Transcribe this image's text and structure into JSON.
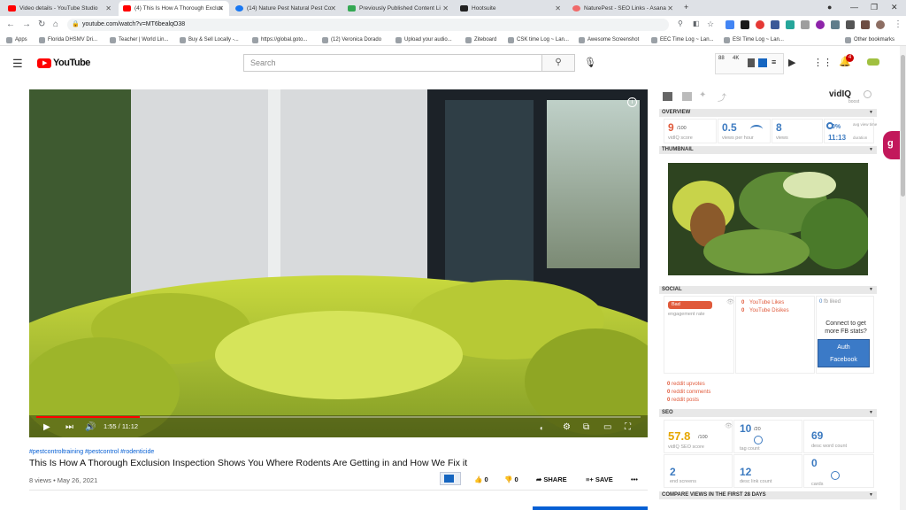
{
  "tabs": [
    {
      "label": "Video details - YouTube Studio",
      "color": "#ff0000"
    },
    {
      "label": "(4) This Is How A Thorough Exclus",
      "color": "#ff0000"
    },
    {
      "label": "(14) Nature Pest Natural Pest Co",
      "color": "#1877f2"
    },
    {
      "label": "Previously Published Content Li",
      "color": "#34a853"
    },
    {
      "label": "Hootsuite",
      "color": "#222222"
    },
    {
      "label": "NaturePest - SEO Links - Asana",
      "color": "#f06a6a"
    }
  ],
  "address": {
    "url": "youtube.com/watch?v=MT6bealqO38"
  },
  "bookmarks": [
    "Apps",
    "Florida DHSMV Dri...",
    "Teacher | World Lin...",
    "Buy & Sell Locally -...",
    "https://global.goto...",
    "(12) Veronica Dorado",
    "Upload your audio...",
    "Ziteboard",
    "CSK time Log ~ Lan...",
    "Awesome Screenshot",
    "EEC Time Log ~ Lan...",
    "ESI Time Log ~ Lan...",
    "Other bookmarks"
  ],
  "youtube": {
    "logo": "YouTube",
    "search_placeholder": "Search",
    "notif_count": "4"
  },
  "player": {
    "time": "1:55 / 11:12",
    "progress": 0.171
  },
  "video": {
    "tags": "#pestcontroltraining #pestcontrol #rodenticide",
    "title": "This Is How A Thorough Exclusion Inspection Shows You Where Rodents Are Getting in and How We Fix it",
    "meta": "8 views • May 26, 2021",
    "likes": "0",
    "dislikes": "0",
    "share": "SHARE",
    "save": "SAVE"
  },
  "vidiq": {
    "logo": "vidIQ",
    "boost": "boost",
    "overview": {
      "title": "OVERVIEW",
      "score": "9",
      "score_max": "/100",
      "score_label": "vidIQ score",
      "vph": "0.5",
      "vph_label": "views per hour",
      "views": "8",
      "views_label": "views",
      "pct": "0%",
      "duration": "11:13",
      "avg_label": "avg view time",
      "dur_label": "duration"
    },
    "thumbnail": {
      "title": "THUMBNAIL"
    },
    "social": {
      "title": "SOCIAL",
      "rate_badge": "Bad",
      "rate_label": "engagement rate",
      "yt_likes": "YouTube Likes",
      "yt_dislikes": "YouTube Disikes",
      "likes_val": "0",
      "dislikes_val": "0",
      "fb_likes": "0",
      "fb_label": "fb liked",
      "connect": "Connect to get more FB stats?",
      "auth_btn": "Auth Facebook",
      "reddit": [
        {
          "v": "0",
          "l": "reddit upvotes"
        },
        {
          "v": "0",
          "l": "reddit comments"
        },
        {
          "v": "0",
          "l": "reddit posts"
        }
      ]
    },
    "seo": {
      "title": "SEO",
      "score": "57.8",
      "score_max": "/100",
      "score_label": "vidIQ SEO score",
      "tags": "10",
      "tags_max": "/20",
      "tag_label": "tag count",
      "desc": "69",
      "desc_label": "desc word count",
      "end": "2",
      "end_label": "end screens",
      "links": "12",
      "links_label": "desc link count",
      "cards": "0",
      "cards_label": "cards"
    },
    "compare": {
      "title": "COMPARE VIEWS IN THE FIRST 28 DAYS"
    }
  }
}
